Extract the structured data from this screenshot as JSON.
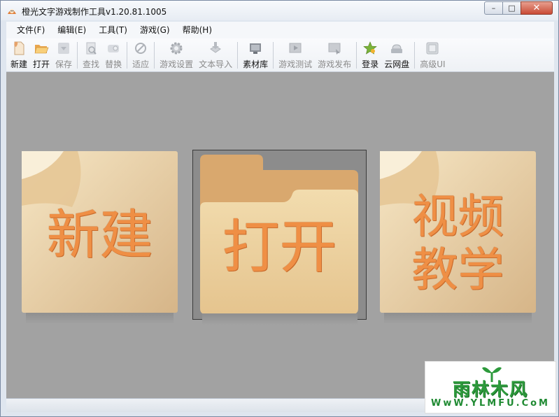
{
  "window": {
    "title": "橙光文字游戏制作工具v1.20.81.1005",
    "buttons": {
      "minimize": "–",
      "maximize": "□",
      "close": "✕"
    }
  },
  "menu": [
    {
      "id": "file",
      "label": "文件(F)"
    },
    {
      "id": "edit",
      "label": "编辑(E)"
    },
    {
      "id": "tools",
      "label": "工具(T)"
    },
    {
      "id": "game",
      "label": "游戏(G)"
    },
    {
      "id": "help",
      "label": "帮助(H)"
    }
  ],
  "toolbar": [
    {
      "id": "new",
      "label": "新建",
      "icon": "new-file-icon",
      "enabled": true
    },
    {
      "id": "open",
      "label": "打开",
      "icon": "open-folder-icon",
      "enabled": true
    },
    {
      "id": "save",
      "label": "保存",
      "icon": "save-icon",
      "enabled": false
    },
    {
      "id": "find",
      "label": "查找",
      "icon": "find-icon",
      "enabled": false
    },
    {
      "id": "replace",
      "label": "替换",
      "icon": "replace-icon",
      "enabled": false
    },
    {
      "id": "fit",
      "label": "适应",
      "icon": "fit-icon",
      "enabled": false
    },
    {
      "id": "game-settings",
      "label": "游戏设置",
      "icon": "gear-icon",
      "enabled": false
    },
    {
      "id": "text-import",
      "label": "文本导入",
      "icon": "import-icon",
      "enabled": false
    },
    {
      "id": "library",
      "label": "素材库",
      "icon": "library-icon",
      "enabled": true
    },
    {
      "id": "test",
      "label": "游戏测试",
      "icon": "play-test-icon",
      "enabled": false
    },
    {
      "id": "publish",
      "label": "游戏发布",
      "icon": "publish-icon",
      "enabled": false
    },
    {
      "id": "login",
      "label": "登录",
      "icon": "star-login-icon",
      "enabled": true
    },
    {
      "id": "cloud",
      "label": "云网盘",
      "icon": "cloud-drive-icon",
      "enabled": true
    },
    {
      "id": "advanced",
      "label": "高级UI",
      "icon": "advanced-ui-icon",
      "enabled": false
    }
  ],
  "tiles": {
    "new": "新建",
    "open": "打开",
    "video_line1": "视频",
    "video_line2": "教学"
  },
  "watermark": {
    "main": "雨林木风",
    "sub": "WwW.YLMFU.CoM"
  },
  "colors": {
    "canvas": "#a2a2a2",
    "tile_text": "#ef8f45",
    "tile_paper": "#e9d3a8",
    "watermark": "#2d9a3c"
  }
}
